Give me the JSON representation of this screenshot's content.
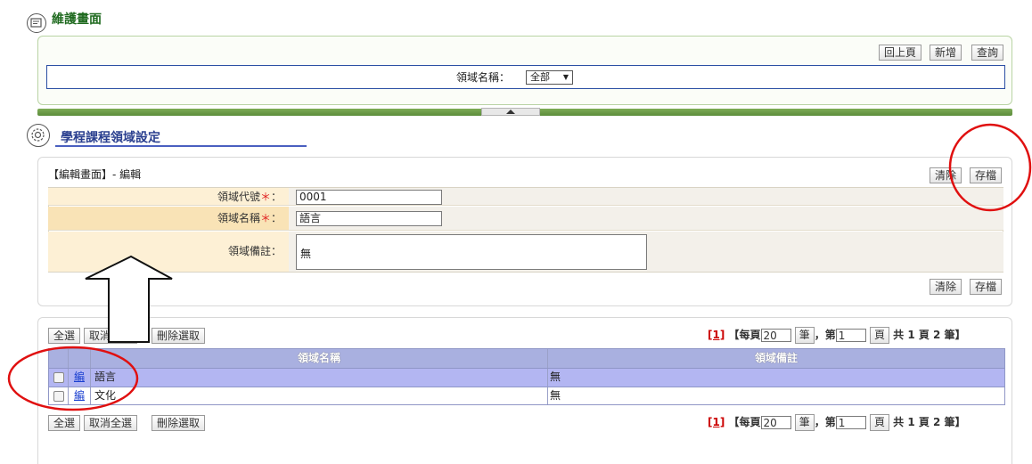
{
  "maintenance": {
    "title": "維護畫面",
    "buttons": {
      "back": "回上頁",
      "add": "新增",
      "query": "查詢"
    },
    "filter": {
      "label": "領域名稱：",
      "select_value": "全部"
    }
  },
  "section": {
    "title": "學程課程領域設定"
  },
  "edit": {
    "header": "【編輯畫面】- 編輯",
    "buttons": {
      "clear": "清除",
      "save": "存檔"
    },
    "fields": {
      "code_label": "領域代號",
      "code_value": "0001",
      "name_label": "領域名稱",
      "name_value": "語言",
      "remark_label": "領域備註：",
      "remark_value": "無",
      "required_mark": "＊",
      "colon": "："
    }
  },
  "list": {
    "buttons": {
      "select_all": "全選",
      "deselect_all": "取消全選",
      "delete_selected": "刪除選取"
    },
    "pager": {
      "page_link": "[1]",
      "per_page_prefix": "【每頁",
      "per_page_value": "20",
      "per_page_unit": "筆",
      "page_prefix": "，第",
      "page_value": "1",
      "page_unit": "頁",
      "summary": "共 1 頁 2 筆】"
    },
    "columns": [
      "領域名稱",
      "領域備註"
    ],
    "edit_link": "編",
    "rows": [
      {
        "name": "語言",
        "remark": "無"
      },
      {
        "name": "文化",
        "remark": "無"
      }
    ]
  },
  "colors": {
    "accent_red": "#e01010",
    "header_purple": "#a9b0e0",
    "row_highlight": "#b3b6f2"
  }
}
